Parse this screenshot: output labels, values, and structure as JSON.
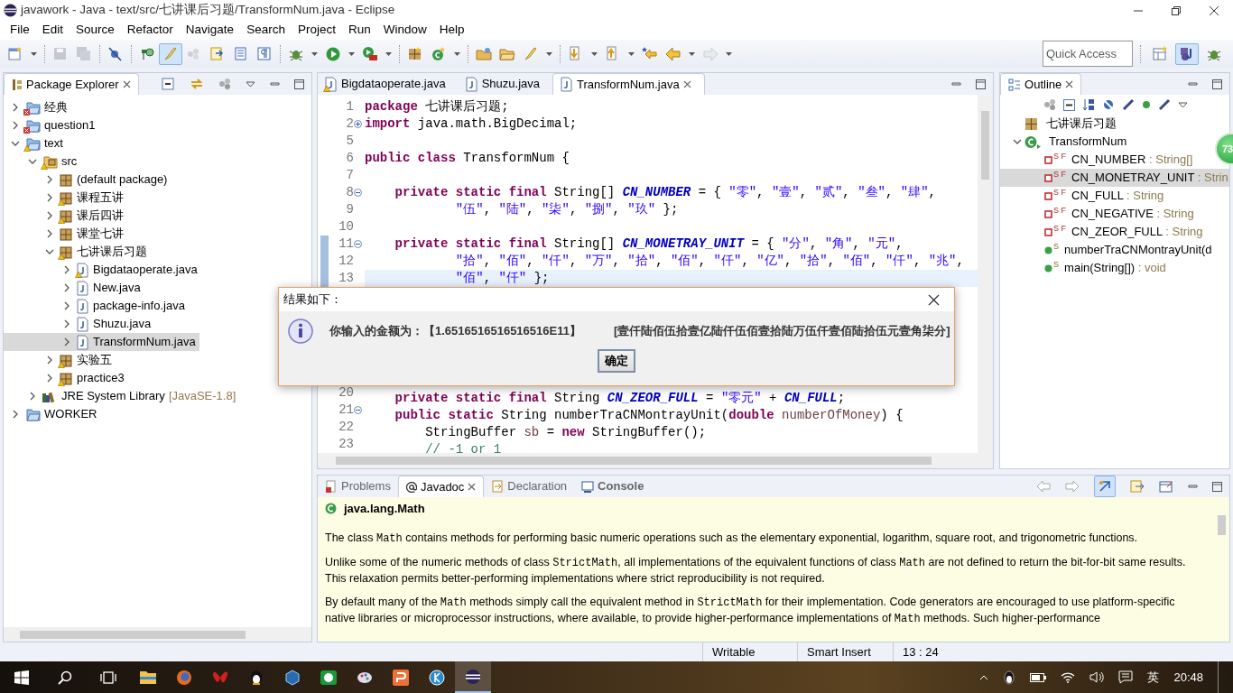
{
  "window": {
    "title": "javawork - Java - text/src/七讲课后习题/TransformNum.java - Eclipse"
  },
  "menu": [
    "File",
    "Edit",
    "Source",
    "Refactor",
    "Navigate",
    "Search",
    "Project",
    "Run",
    "Window",
    "Help"
  ],
  "toolbar": [
    [
      {
        "kind": "new",
        "dropdown": true,
        "disabled": false,
        "selected": false
      }
    ],
    [
      {
        "kind": "save",
        "dropdown": false,
        "disabled": true,
        "selected": false
      },
      {
        "kind": "save_all",
        "dropdown": false,
        "disabled": true,
        "selected": false
      }
    ],
    [
      {
        "kind": "skip",
        "dropdown": false,
        "disabled": false,
        "selected": false
      }
    ],
    [
      {
        "kind": "open_type",
        "dropdown": false,
        "disabled": false,
        "selected": false
      },
      {
        "kind": "brush",
        "dropdown": false,
        "disabled": false,
        "selected": true
      },
      {
        "kind": "dots",
        "dropdown": false,
        "disabled": true,
        "selected": false
      },
      {
        "kind": "doc_arrows",
        "dropdown": false,
        "disabled": false,
        "selected": false
      },
      {
        "kind": "doc_lines",
        "dropdown": false,
        "disabled": false,
        "selected": false
      },
      {
        "kind": "pilcrow",
        "dropdown": false,
        "disabled": false,
        "selected": false
      }
    ],
    [
      {
        "kind": "bug",
        "dropdown": true,
        "disabled": false,
        "selected": false
      },
      {
        "kind": "run",
        "dropdown": true,
        "disabled": false,
        "selected": false
      },
      {
        "kind": "run_tools",
        "dropdown": true,
        "disabled": false,
        "selected": false
      }
    ],
    [
      {
        "kind": "package",
        "dropdown": false,
        "disabled": false,
        "selected": false
      },
      {
        "kind": "class",
        "dropdown": true,
        "disabled": false,
        "selected": false
      }
    ],
    [
      {
        "kind": "folder",
        "dropdown": false,
        "disabled": false,
        "selected": false
      },
      {
        "kind": "folder_open",
        "dropdown": false,
        "disabled": false,
        "selected": false
      },
      {
        "kind": "brush",
        "dropdown": true,
        "disabled": false,
        "selected": false
      }
    ],
    [
      {
        "kind": "arrow_down",
        "dropdown": true,
        "disabled": false,
        "selected": false
      },
      {
        "kind": "arrow_up",
        "dropdown": true,
        "disabled": false,
        "selected": false
      },
      {
        "kind": "back_star",
        "dropdown": false,
        "disabled": false,
        "selected": false
      },
      {
        "kind": "back",
        "dropdown": true,
        "disabled": false,
        "selected": false
      },
      {
        "kind": "forward",
        "dropdown": true,
        "disabled": true,
        "selected": false
      }
    ]
  ],
  "quick_access": {
    "placeholder": "Quick Access"
  },
  "perspectives": [
    {
      "kind": "open",
      "selected": false
    },
    {
      "kind": "java",
      "selected": true
    },
    {
      "kind": "bug",
      "selected": false
    }
  ],
  "package_explorer": {
    "title": "Package Explorer",
    "tree": [
      {
        "kind": "project",
        "label": "经典",
        "error": true,
        "warning": false,
        "expanded": false,
        "selected": false
      },
      {
        "kind": "project",
        "label": "question1",
        "error": true,
        "warning": false,
        "expanded": false,
        "selected": false
      },
      {
        "kind": "project",
        "label": "text",
        "error": false,
        "warning": true,
        "expanded": true,
        "selected": false,
        "children": [
          {
            "kind": "src",
            "label": "src",
            "error": false,
            "warning": true,
            "expanded": true,
            "selected": false,
            "children": [
              {
                "kind": "package",
                "label": "(default package)",
                "error": false,
                "warning": false,
                "expanded": false,
                "selected": false
              },
              {
                "kind": "package",
                "label": "课程五讲",
                "error": false,
                "warning": true,
                "expanded": false,
                "selected": false
              },
              {
                "kind": "package",
                "label": "课后四讲",
                "error": false,
                "warning": true,
                "expanded": false,
                "selected": false
              },
              {
                "kind": "package",
                "label": "课堂七讲",
                "error": false,
                "warning": false,
                "expanded": false,
                "selected": false
              },
              {
                "kind": "package",
                "label": "七讲课后习题",
                "error": false,
                "warning": true,
                "expanded": true,
                "selected": false,
                "children": [
                  {
                    "kind": "java",
                    "label": "Bigdataoperate.java",
                    "error": false,
                    "warning": true,
                    "expanded": false,
                    "selected": false
                  },
                  {
                    "kind": "java",
                    "label": "New.java",
                    "error": false,
                    "warning": false,
                    "expanded": false,
                    "selected": false
                  },
                  {
                    "kind": "java",
                    "label": "package-info.java",
                    "error": false,
                    "warning": false,
                    "expanded": false,
                    "selected": false
                  },
                  {
                    "kind": "java",
                    "label": "Shuzu.java",
                    "error": false,
                    "warning": false,
                    "expanded": false,
                    "selected": false
                  },
                  {
                    "kind": "java",
                    "label": "TransformNum.java",
                    "error": false,
                    "warning": false,
                    "expanded": false,
                    "selected": true
                  }
                ]
              },
              {
                "kind": "package",
                "label": "实验五",
                "error": false,
                "warning": true,
                "expanded": false,
                "selected": false
              },
              {
                "kind": "package",
                "label": "practice3",
                "error": false,
                "warning": true,
                "expanded": false,
                "selected": false
              }
            ]
          },
          {
            "kind": "library",
            "label": "JRE System Library",
            "suffix": "[JavaSE-1.8]",
            "error": false,
            "warning": false,
            "expanded": false,
            "selected": false
          }
        ]
      },
      {
        "kind": "project",
        "label": "WORKER",
        "error": false,
        "warning": false,
        "expanded": false,
        "selected": false
      }
    ]
  },
  "editor": {
    "tabs": [
      {
        "label": "Bigdataoperate.java",
        "warning": true,
        "selected": false
      },
      {
        "label": "Shuzu.java",
        "warning": false,
        "selected": false
      },
      {
        "label": "TransformNum.java",
        "warning": false,
        "selected": true
      }
    ],
    "lines_top": [
      {
        "number": "1",
        "fold_marker": false,
        "folded": false,
        "changed": false,
        "current": false,
        "tokens": [
          {
            "kind": "kw",
            "text": "package"
          },
          {
            "kind": "plain",
            "text": " 七讲课后习题;"
          }
        ]
      },
      {
        "number": "2",
        "fold_marker": true,
        "folded": true,
        "changed": false,
        "current": false,
        "tokens": [
          {
            "kind": "kw",
            "text": "import"
          },
          {
            "kind": "plain",
            "text": " java.math.BigDecimal;"
          }
        ]
      },
      {
        "number": "5",
        "fold_marker": false,
        "folded": false,
        "changed": false,
        "current": false
      },
      {
        "number": "6",
        "fold_marker": false,
        "folded": false,
        "changed": false,
        "current": false,
        "tokens": [
          {
            "kind": "kw",
            "text": "public class"
          },
          {
            "kind": "plain",
            "text": " TransformNum {"
          }
        ]
      },
      {
        "number": "7",
        "fold_marker": false,
        "folded": false,
        "changed": false,
        "current": false
      },
      {
        "number": "8",
        "fold_marker": true,
        "folded": false,
        "changed": false,
        "current": false,
        "tokens": [
          {
            "kind": "kw",
            "text": "    private static final"
          },
          {
            "kind": "plain",
            "text": " String[] "
          },
          {
            "kind": "field",
            "text": "CN_NUMBER"
          },
          {
            "kind": "plain",
            "text": " = { "
          },
          {
            "kind": "str",
            "text": "\"零\""
          },
          {
            "kind": "plain",
            "text": ", "
          },
          {
            "kind": "str",
            "text": "\"壹\""
          },
          {
            "kind": "plain",
            "text": ", "
          },
          {
            "kind": "str",
            "text": "\"贰\""
          },
          {
            "kind": "plain",
            "text": ", "
          },
          {
            "kind": "str",
            "text": "\"叁\""
          },
          {
            "kind": "plain",
            "text": ", "
          },
          {
            "kind": "str",
            "text": "\"肆\""
          },
          {
            "kind": "plain",
            "text": ","
          }
        ]
      },
      {
        "number": "9",
        "fold_marker": false,
        "folded": false,
        "changed": false,
        "current": false,
        "tokens": [
          {
            "kind": "str",
            "text": "            \"伍\""
          },
          {
            "kind": "plain",
            "text": ", "
          },
          {
            "kind": "str",
            "text": "\"陆\""
          },
          {
            "kind": "plain",
            "text": ", "
          },
          {
            "kind": "str",
            "text": "\"柒\""
          },
          {
            "kind": "plain",
            "text": ", "
          },
          {
            "kind": "str",
            "text": "\"捌\""
          },
          {
            "kind": "plain",
            "text": ", "
          },
          {
            "kind": "str",
            "text": "\"玖\""
          },
          {
            "kind": "plain",
            "text": " };"
          }
        ]
      },
      {
        "number": "10",
        "fold_marker": false,
        "folded": false,
        "changed": false,
        "current": false
      },
      {
        "number": "11",
        "fold_marker": true,
        "folded": false,
        "changed": true,
        "current": false,
        "tokens": [
          {
            "kind": "kw",
            "text": "    private static final"
          },
          {
            "kind": "plain",
            "text": " String[] "
          },
          {
            "kind": "field",
            "text": "CN_MONETRAY_UNIT"
          },
          {
            "kind": "plain",
            "text": " = { "
          },
          {
            "kind": "str",
            "text": "\"分\""
          },
          {
            "kind": "plain",
            "text": ", "
          },
          {
            "kind": "str",
            "text": "\"角\""
          },
          {
            "kind": "plain",
            "text": ", "
          },
          {
            "kind": "str",
            "text": "\"元\""
          },
          {
            "kind": "plain",
            "text": ","
          }
        ]
      },
      {
        "number": "12",
        "fold_marker": false,
        "folded": false,
        "changed": true,
        "current": false,
        "tokens": [
          {
            "kind": "str",
            "text": "            \"拾\""
          },
          {
            "kind": "plain",
            "text": ", "
          },
          {
            "kind": "str",
            "text": "\"佰\""
          },
          {
            "kind": "plain",
            "text": ", "
          },
          {
            "kind": "str",
            "text": "\"仟\""
          },
          {
            "kind": "plain",
            "text": ", "
          },
          {
            "kind": "str",
            "text": "\"万\""
          },
          {
            "kind": "plain",
            "text": ", "
          },
          {
            "kind": "str",
            "text": "\"拾\""
          },
          {
            "kind": "plain",
            "text": ", "
          },
          {
            "kind": "str",
            "text": "\"佰\""
          },
          {
            "kind": "plain",
            "text": ", "
          },
          {
            "kind": "str",
            "text": "\"仟\""
          },
          {
            "kind": "plain",
            "text": ", "
          },
          {
            "kind": "str",
            "text": "\"亿\""
          },
          {
            "kind": "plain",
            "text": ", "
          },
          {
            "kind": "str",
            "text": "\"拾\""
          },
          {
            "kind": "plain",
            "text": ", "
          },
          {
            "kind": "str",
            "text": "\"佰\""
          },
          {
            "kind": "plain",
            "text": ", "
          },
          {
            "kind": "str",
            "text": "\"仟\""
          },
          {
            "kind": "plain",
            "text": ", "
          },
          {
            "kind": "str",
            "text": "\"兆\""
          },
          {
            "kind": "plain",
            "text": ","
          }
        ]
      },
      {
        "number": "13",
        "fold_marker": false,
        "folded": false,
        "changed": true,
        "current": true,
        "tokens": [
          {
            "kind": "str",
            "text": "            \"佰\""
          },
          {
            "kind": "plain",
            "text": ", "
          },
          {
            "kind": "str",
            "text": "\"仟\""
          },
          {
            "kind": "plain",
            "text": " };"
          }
        ]
      }
    ],
    "lines_bottom": [
      {
        "number": "20",
        "fold_marker": false,
        "folded": false,
        "changed": false,
        "current": false,
        "tokens": [
          {
            "kind": "kw",
            "text": "    private static final"
          },
          {
            "kind": "plain",
            "text": " String "
          },
          {
            "kind": "field",
            "text": "CN_ZEOR_FULL"
          },
          {
            "kind": "plain",
            "text": " = "
          },
          {
            "kind": "str",
            "text": "\"零元\""
          },
          {
            "kind": "plain",
            "text": " + "
          },
          {
            "kind": "field",
            "text": "CN_FULL"
          },
          {
            "kind": "plain",
            "text": ";"
          }
        ]
      },
      {
        "number": "21",
        "fold_marker": true,
        "folded": false,
        "changed": false,
        "current": false,
        "tokens": [
          {
            "kind": "kw",
            "text": "    public static"
          },
          {
            "kind": "plain",
            "text": " String numberTraCNMontrayUnit("
          },
          {
            "kind": "kw",
            "text": "double"
          },
          {
            "kind": "param",
            "text": " numberOfMoney"
          },
          {
            "kind": "plain",
            "text": ") {"
          }
        ]
      },
      {
        "number": "22",
        "fold_marker": false,
        "folded": false,
        "changed": false,
        "current": false,
        "tokens": [
          {
            "kind": "plain",
            "text": "        StringBuffer "
          },
          {
            "kind": "param",
            "text": "sb"
          },
          {
            "kind": "plain",
            "text": " = "
          },
          {
            "kind": "kw",
            "text": "new"
          },
          {
            "kind": "plain",
            "text": " StringBuffer();"
          }
        ]
      },
      {
        "number": "23",
        "fold_marker": false,
        "folded": false,
        "changed": false,
        "current": false,
        "tokens": [
          {
            "kind": "comment",
            "text": "        // -1 or 1"
          }
        ]
      }
    ]
  },
  "outline": {
    "title": "Outline",
    "items": [
      {
        "kind": "package",
        "label": "七讲课后习题",
        "selected": false
      },
      {
        "kind": "class",
        "label": "TransformNum",
        "expanded": true,
        "selected": false,
        "children": [
          {
            "kind": "field",
            "label": "CN_NUMBER",
            "type": " : String[]",
            "modifiers": "S F",
            "selected": false
          },
          {
            "kind": "field",
            "label": "CN_MONETRAY_UNIT",
            "type": " : Strin",
            "modifiers": "S F",
            "selected": true
          },
          {
            "kind": "field",
            "label": "CN_FULL",
            "type": " : String",
            "modifiers": "S F",
            "selected": false
          },
          {
            "kind": "field",
            "label": "CN_NEGATIVE",
            "type": " : String",
            "modifiers": "S F",
            "selected": false
          },
          {
            "kind": "field",
            "label": "CN_ZEOR_FULL",
            "type": " : String",
            "modifiers": "S F",
            "selected": false
          },
          {
            "kind": "method",
            "label": "numberTraCNMontrayUnit(d",
            "modifiers": "S",
            "selected": false
          },
          {
            "kind": "method",
            "label": "main(String[])",
            "type": " : void",
            "modifiers": "S",
            "selected": false
          }
        ]
      }
    ]
  },
  "floating_badge": "73",
  "bottom_panel": {
    "tabs": [
      {
        "label": "Problems",
        "kind": "problems",
        "selected": false,
        "emphasized": false,
        "closable": false
      },
      {
        "label": "Javadoc",
        "kind": "javadoc",
        "selected": true,
        "emphasized": false,
        "closable": true
      },
      {
        "label": "Declaration",
        "kind": "declaration",
        "selected": false,
        "emphasized": false,
        "closable": false
      },
      {
        "label": "Console",
        "kind": "console",
        "selected": false,
        "emphasized": true,
        "closable": false
      }
    ],
    "javadoc": {
      "title": "java.lang.Math",
      "paragraphs": [
        [
          {
            "kind": "text",
            "text": "The class "
          },
          {
            "kind": "code",
            "text": "Math"
          },
          {
            "kind": "text",
            "text": " contains methods for performing basic numeric operations such as the elementary exponential, logarithm, square root, and trigonometric functions."
          }
        ],
        [
          {
            "kind": "text",
            "text": "Unlike some of the numeric methods of class "
          },
          {
            "kind": "code",
            "text": "StrictMath"
          },
          {
            "kind": "text",
            "text": ", all implementations of the equivalent functions of class "
          },
          {
            "kind": "code",
            "text": "Math"
          },
          {
            "kind": "text",
            "text": " are not defined to return the bit-for-bit same results. This relaxation permits better-performing implementations where strict reproducibility is not required."
          }
        ],
        [
          {
            "kind": "text",
            "text": "By default many of the "
          },
          {
            "kind": "code",
            "text": "Math"
          },
          {
            "kind": "text",
            "text": " methods simply call the equivalent method in "
          },
          {
            "kind": "code",
            "text": "StrictMath"
          },
          {
            "kind": "text",
            "text": " for their implementation. Code generators are encouraged to use platform-specific native libraries or microprocessor instructions, where available, to provide higher-performance implementations of "
          },
          {
            "kind": "code",
            "text": "Math"
          },
          {
            "kind": "text",
            "text": " methods. Such higher-performance"
          }
        ]
      ]
    }
  },
  "status_bar": [
    "Writable",
    "Smart Insert",
    "13 : 24"
  ],
  "dialog": {
    "title": "结果如下：",
    "message": "你输入的金额为：【1.6516516516516516E11】",
    "result": "[壹仟陆佰伍拾壹亿陆仟伍佰壹拾陆万伍仟壹佰陆拾伍元壹角柒分]",
    "button": "确定"
  },
  "taskbar": {
    "apps": [
      {
        "kind": "explorer",
        "active": false
      },
      {
        "kind": "firefox",
        "active": false
      },
      {
        "kind": "butterfly",
        "active": false
      },
      {
        "kind": "penguin",
        "active": false
      },
      {
        "kind": "cube",
        "active": false
      },
      {
        "kind": "chat",
        "active": false
      },
      {
        "kind": "paint",
        "active": false
      },
      {
        "kind": "slides",
        "active": false
      },
      {
        "kind": "k",
        "active": false
      },
      {
        "kind": "eclipse",
        "active": true
      }
    ],
    "ime": "英",
    "time": "20:48"
  }
}
